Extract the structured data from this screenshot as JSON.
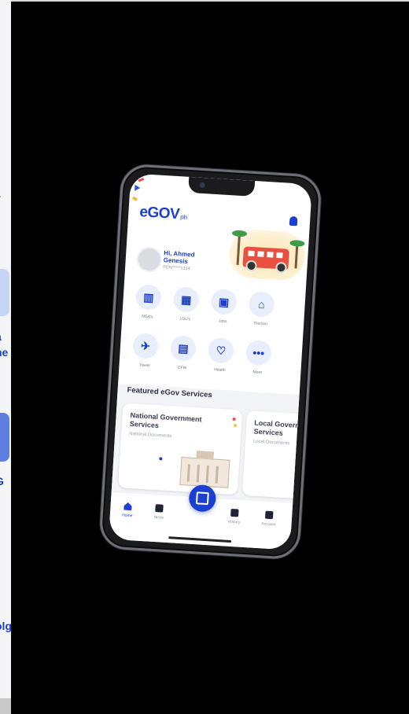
{
  "app": {
    "logo_text": "eGOV",
    "logo_suffix": "ph",
    "greeting": "Hi, Ahmed Genesis",
    "pcn": "PCN*****1314"
  },
  "services": [
    {
      "label": "NGA's",
      "icon": "building-icon"
    },
    {
      "label": "LGU's",
      "icon": "city-hall-icon"
    },
    {
      "label": "Jobs",
      "icon": "briefcase-icon"
    },
    {
      "label": "Tourism",
      "icon": "landmark-icon"
    },
    {
      "label": "Travel",
      "icon": "plane-icon"
    },
    {
      "label": "OFW",
      "icon": "passport-icon"
    },
    {
      "label": "Health",
      "icon": "heart-pulse-icon"
    },
    {
      "label": "More",
      "icon": "more-icon"
    }
  ],
  "featured": {
    "title": "Featured eGov Services",
    "cards": [
      {
        "title": "National Government Services",
        "subtitle": "National Documents"
      },
      {
        "title": "Local Government Services",
        "subtitle": "Local Documents"
      }
    ]
  },
  "nav": [
    {
      "label": "Home",
      "active": true
    },
    {
      "label": "News",
      "active": false
    },
    {
      "label": "History",
      "active": false
    },
    {
      "label": "Account",
      "active": false
    }
  ],
  "left_fragments": [
    "T",
    "a",
    "ne",
    "G",
    "olg"
  ],
  "colors": {
    "brand": "#1a3fd1",
    "background": "#000000",
    "card_bg": "#ffffff",
    "hero_accent": "#e9503f"
  }
}
